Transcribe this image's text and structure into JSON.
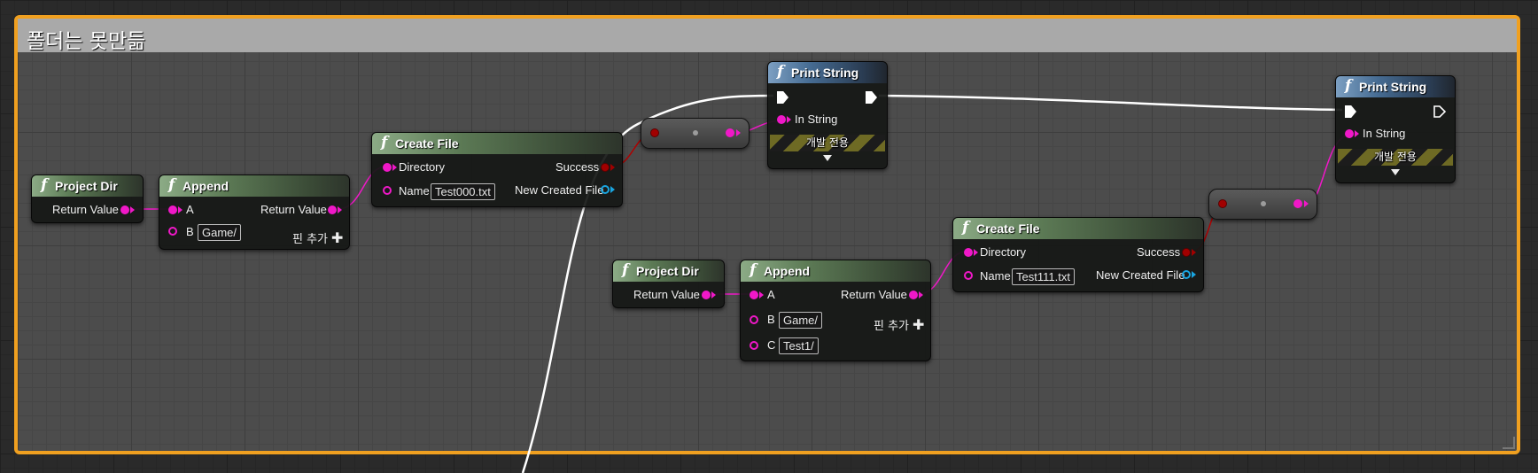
{
  "comment": {
    "title": "폴더는 못만듦"
  },
  "colors": {
    "comment_border": "#f0a020",
    "pure_function_header": "#5c7a55",
    "print_header": "#466c93",
    "string_pin": "#f018c8",
    "bool_pin": "#a10000",
    "object_pin": "#19a5e0",
    "exec_wire": "#ffffff"
  },
  "nodes": {
    "project_dir_1": {
      "title": "Project Dir",
      "return_label": "Return Value"
    },
    "append_1": {
      "title": "Append",
      "a_label": "A",
      "b_label": "B",
      "b_value": "Game/",
      "return_label": "Return Value",
      "add_pin_label": "핀 추가"
    },
    "create_file_1": {
      "title": "Create File",
      "directory_label": "Directory",
      "name_label": "Name",
      "name_value": "Test000.txt",
      "success_label": "Success",
      "new_file_label": "New Created File"
    },
    "print_1": {
      "title": "Print String",
      "in_string_label": "In String",
      "dev_only_label": "개발 전용"
    },
    "project_dir_2": {
      "title": "Project Dir",
      "return_label": "Return Value"
    },
    "append_2": {
      "title": "Append",
      "a_label": "A",
      "b_label": "B",
      "b_value": "Game/",
      "c_label": "C",
      "c_value": "Test1/",
      "return_label": "Return Value",
      "add_pin_label": "핀 추가"
    },
    "create_file_2": {
      "title": "Create File",
      "directory_label": "Directory",
      "name_label": "Name",
      "name_value": "Test111.txt",
      "success_label": "Success",
      "new_file_label": "New Created File"
    },
    "print_2": {
      "title": "Print String",
      "in_string_label": "In String",
      "dev_only_label": "개발 전용"
    }
  },
  "icons": {
    "function": "f",
    "exec_pin": "exec-arrow-icon",
    "add_pin": "plus-icon",
    "expand": "chevron-down-icon"
  }
}
